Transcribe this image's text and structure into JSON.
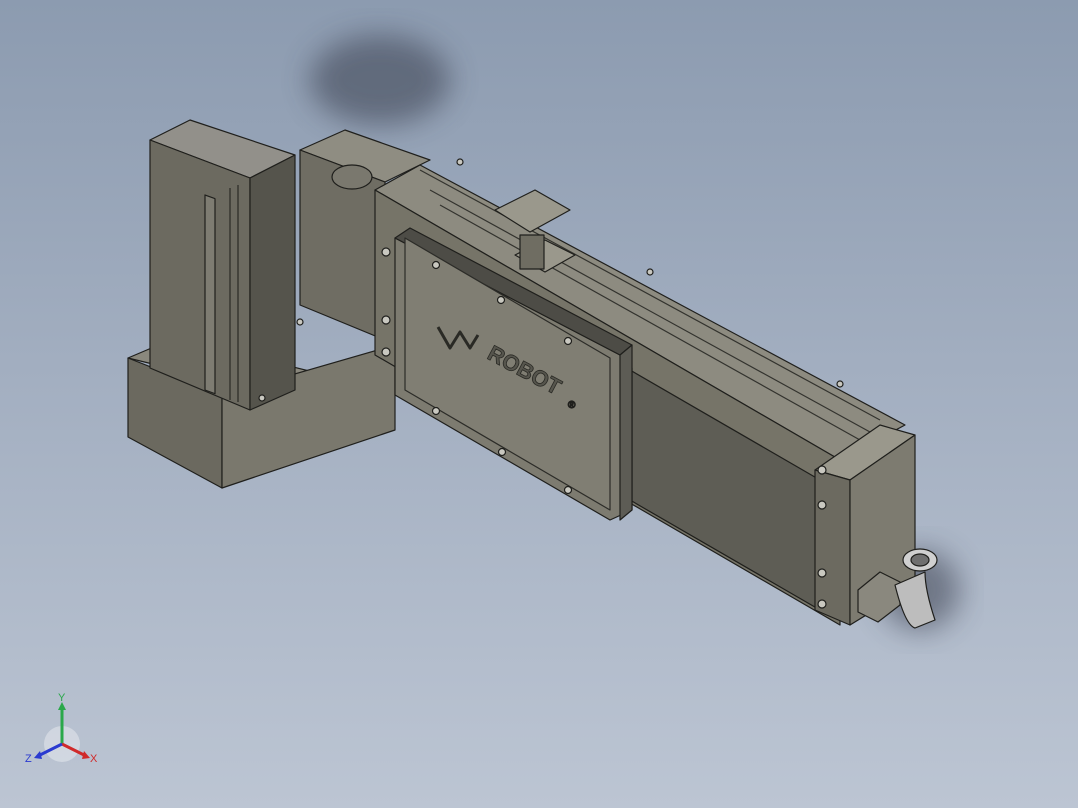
{
  "viewport": {
    "background_top": "#8c9bb0",
    "background_bottom": "#bcc5d3"
  },
  "model": {
    "brand_text": "ROBOT",
    "brand_mark": "®",
    "body_color": "#7d7b70",
    "edge_color": "#1f1f1c"
  },
  "triad": {
    "x_label": "X",
    "y_label": "Y",
    "z_label": "Z",
    "x_color": "#d02a2a",
    "y_color": "#2aa84a",
    "z_color": "#2a3ad0"
  }
}
